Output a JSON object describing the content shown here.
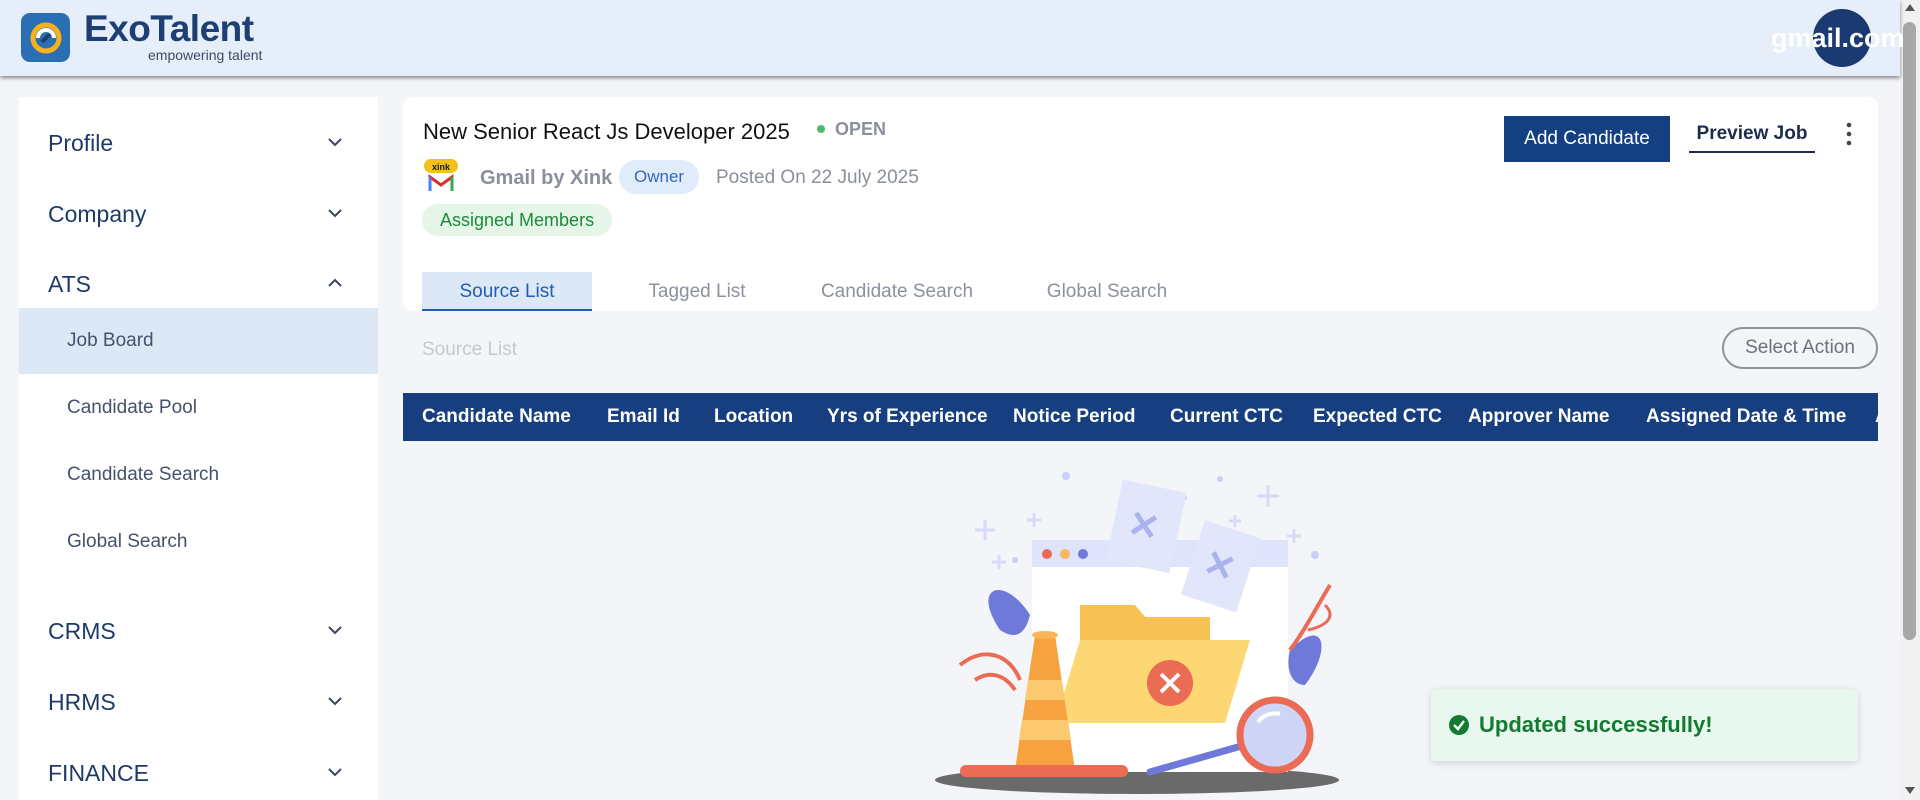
{
  "header": {
    "logo_name": "ExoTalent",
    "logo_tagline": "empowering talent",
    "user_email_fragment": "gmail.com"
  },
  "sidebar": {
    "sections": [
      {
        "label": "Profile",
        "expanded": false
      },
      {
        "label": "Company",
        "expanded": false
      },
      {
        "label": "ATS",
        "expanded": true
      },
      {
        "label": "CRMS",
        "expanded": false
      },
      {
        "label": "HRMS",
        "expanded": false
      },
      {
        "label": "FINANCE",
        "expanded": false
      }
    ],
    "ats_items": [
      {
        "label": "Job Board",
        "active": true
      },
      {
        "label": "Candidate Pool",
        "active": false
      },
      {
        "label": "Candidate Search",
        "active": false
      },
      {
        "label": "Global Search",
        "active": false
      }
    ]
  },
  "job": {
    "title": "New Senior React Js Developer 2025",
    "status": "OPEN",
    "company": "Gmail by Xink",
    "company_logo_text": "xink",
    "role": "Owner",
    "posted": "Posted On 22 July 2025",
    "assigned_members": "Assigned Members",
    "add_candidate": "Add Candidate",
    "preview_job": "Preview Job"
  },
  "tabs": [
    {
      "label": "Source List",
      "active": true
    },
    {
      "label": "Tagged List",
      "active": false
    },
    {
      "label": "Candidate Search",
      "active": false
    },
    {
      "label": "Global Search",
      "active": false
    }
  ],
  "list": {
    "label": "Source List",
    "select_action": "Select Action",
    "columns": [
      "Candidate Name",
      "Email Id",
      "Location",
      "Yrs of Experience",
      "Notice Period",
      "Current CTC",
      "Expected CTC",
      "Approver Name",
      "Assigned Date & Time",
      "A"
    ]
  },
  "toast": {
    "message": "Updated successfully!"
  },
  "colors": {
    "primary": "#143f80",
    "status_open": "#4dbb6e",
    "toast_text": "#137a34",
    "sidebar_active": "#dde8f7"
  }
}
